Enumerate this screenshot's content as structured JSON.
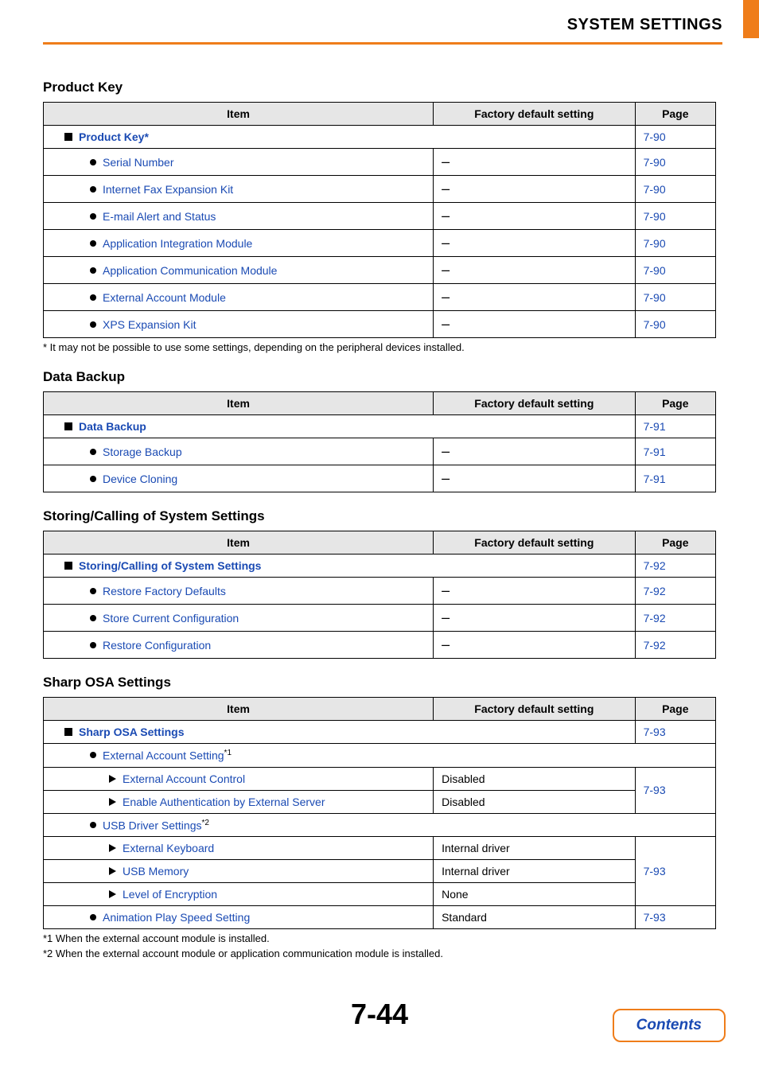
{
  "header": {
    "title": "SYSTEM SETTINGS"
  },
  "tableHeaders": {
    "item": "Item",
    "factory": "Factory default setting",
    "page": "Page"
  },
  "sections": {
    "productKey": {
      "heading": "Product Key",
      "groupLabel": "Product Key",
      "groupSuffix": "*",
      "groupPage": "7-90",
      "rows": [
        {
          "label": "Serial Number",
          "value": "–",
          "page": "7-90"
        },
        {
          "label": "Internet Fax Expansion Kit",
          "value": "–",
          "page": "7-90"
        },
        {
          "label": "E-mail Alert and Status",
          "value": "–",
          "page": "7-90"
        },
        {
          "label": "Application Integration Module",
          "value": "–",
          "page": "7-90"
        },
        {
          "label": "Application Communication Module",
          "value": "–",
          "page": "7-90"
        },
        {
          "label": "External Account Module",
          "value": "–",
          "page": "7-90"
        },
        {
          "label": "XPS Expansion Kit",
          "value": "–",
          "page": "7-90"
        }
      ],
      "footnote": "*  It may not be possible to use some settings, depending on the peripheral devices installed."
    },
    "dataBackup": {
      "heading": "Data Backup",
      "groupLabel": "Data Backup",
      "groupPage": "7-91",
      "rows": [
        {
          "label": "Storage Backup",
          "value": "–",
          "page": "7-91"
        },
        {
          "label": "Device Cloning",
          "value": "–",
          "page": "7-91"
        }
      ]
    },
    "storingCalling": {
      "heading": "Storing/Calling of System Settings",
      "groupLabel": "Storing/Calling of System Settings",
      "groupPage": "7-92",
      "rows": [
        {
          "label": "Restore Factory Defaults",
          "value": "–",
          "page": "7-92"
        },
        {
          "label": "Store Current Configuration",
          "value": "–",
          "page": "7-92"
        },
        {
          "label": "Restore Configuration",
          "value": "–",
          "page": "7-92"
        }
      ]
    },
    "sharpOSA": {
      "heading": "Sharp OSA Settings",
      "groupLabel": "Sharp OSA Settings",
      "groupPage": "7-93",
      "sub1": {
        "label": "External Account Setting",
        "sup": "*1",
        "rows": [
          {
            "label": "External Account Control",
            "value": "Disabled"
          },
          {
            "label": "Enable Authentication by External Server",
            "value": "Disabled"
          }
        ],
        "page": "7-93"
      },
      "sub2": {
        "label": "USB Driver Settings",
        "sup": "*2",
        "rows": [
          {
            "label": "External Keyboard",
            "value": "Internal driver"
          },
          {
            "label": "USB Memory",
            "value": "Internal driver"
          },
          {
            "label": "Level of Encryption",
            "value": "None"
          }
        ],
        "page": "7-93"
      },
      "animRow": {
        "label": "Animation Play Speed Setting",
        "value": "Standard",
        "page": "7-93"
      },
      "footnote1": "*1  When the external account module is installed.",
      "footnote2": "*2  When the external account module or application communication module is installed."
    }
  },
  "footer": {
    "pageNumber": "7-44",
    "contents": "Contents"
  }
}
